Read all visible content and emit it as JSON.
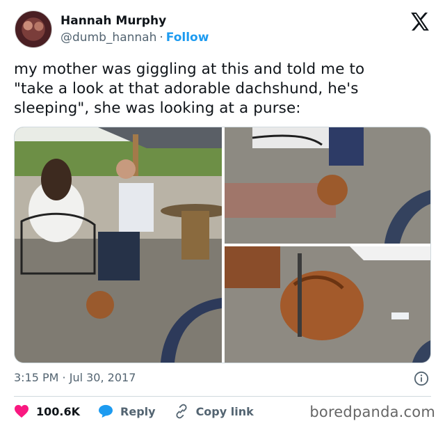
{
  "author": {
    "name": "Hannah Murphy",
    "handle": "@dumb_hannah",
    "separator": "·",
    "follow_label": "Follow"
  },
  "tweet": {
    "text_line1": "my mother was giggling at this and told me to",
    "text_line2": "\"take a look at that adorable dachshund, he's",
    "text_line3": "sleeping\", she was looking at a purse:"
  },
  "meta": {
    "timestamp": "3:15 PM · Jul 30, 2017"
  },
  "actions": {
    "likes": "100.6K",
    "reply_label": "Reply",
    "copy_label": "Copy link"
  },
  "watermark": "boredpanda.com",
  "colors": {
    "accent": "#1d9bf0",
    "like": "#f91880",
    "muted": "#536471"
  }
}
